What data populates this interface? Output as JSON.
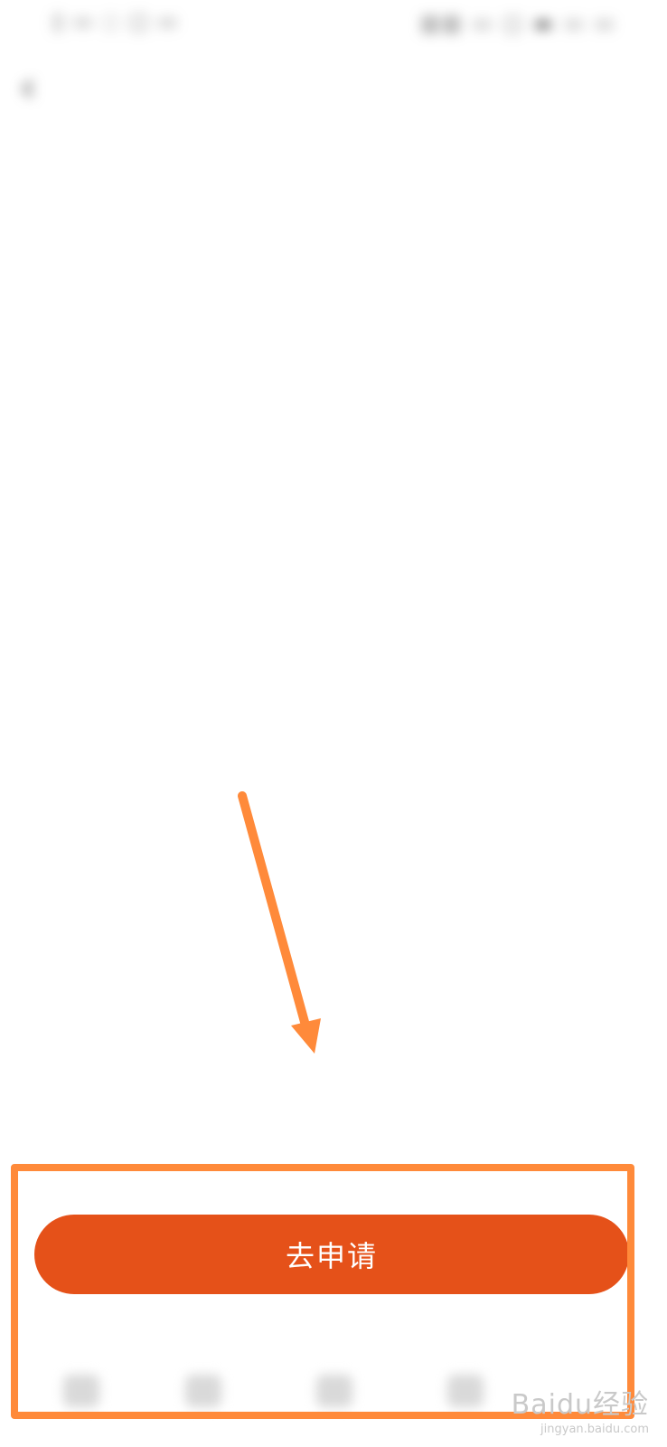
{
  "status_bar": {
    "left_text": "▯ ▭ ◌ ▢ ▭",
    "right_text": "▥▥ ▭ ▢ ▬ ▭ ▭"
  },
  "nav": {
    "back_icon": "chevron-left-icon",
    "back_glyph": "‹",
    "title": ""
  },
  "content": {
    "greeting": "",
    "paragraph": ""
  },
  "apply_button": {
    "label": "去申请"
  },
  "annotation": {
    "arrow_color": "#ff8a3a",
    "box_color": "#ff8a3a"
  },
  "colors": {
    "button": "#e55119",
    "background": "#ffffff"
  },
  "watermark": {
    "brand": "Baidu经验",
    "url": "jingyan.baidu.com"
  }
}
